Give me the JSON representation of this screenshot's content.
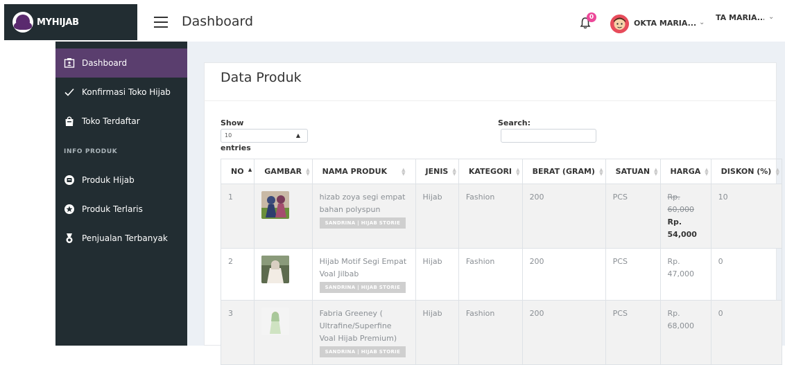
{
  "brand": {
    "name": "MYHIJAB"
  },
  "header": {
    "title": "Dashboard",
    "notification_count": "0",
    "user_name": "OKTA MARIA...",
    "user_name_overflow": "TA MARIA..."
  },
  "sidebar": {
    "items": [
      {
        "label": "Dashboard",
        "icon": "dashboard-icon",
        "active": true
      },
      {
        "label": "Konfirmasi Toko Hijab",
        "icon": "check-icon"
      },
      {
        "label": "Toko Terdaftar",
        "icon": "shopping-bag-icon"
      }
    ],
    "section_header": "INFO PRODUK",
    "section_items": [
      {
        "label": "Produk Hijab",
        "icon": "box-icon"
      },
      {
        "label": "Produk Terlaris",
        "icon": "star-icon"
      },
      {
        "label": "Penjualan Terbanyak",
        "icon": "medal-icon"
      }
    ]
  },
  "content": {
    "card_title": "Data Produk",
    "show_label": "Show",
    "entries_value": "10",
    "entries_label": "entries",
    "search_label": "Search:",
    "search_value": "",
    "columns": [
      "NO",
      "GAMBAR",
      "NAMA PRODUK",
      "JENIS",
      "KATEGORI",
      "BERAT (GRAM)",
      "SATUAN",
      "HARGA",
      "DISKON (%)"
    ],
    "rows": [
      {
        "no": "1",
        "name": "hizab zoya segi empat bahan polyspun",
        "shop": "SANDRINA | HIJAB STORIE",
        "jenis": "Hijab",
        "kategori": "Fashion",
        "berat": "200",
        "satuan": "PCS",
        "harga_old": "Rp. 60,000",
        "harga_new": "Rp. 54,000",
        "diskon": "10"
      },
      {
        "no": "2",
        "name": "Hijab Motif Segi Empat Voal Jilbab",
        "shop": "SANDRINA | HIJAB STORIE",
        "jenis": "Hijab",
        "kategori": "Fashion",
        "berat": "200",
        "satuan": "PCS",
        "harga": "Rp. 47,000",
        "diskon": "0"
      },
      {
        "no": "3",
        "name": "Fabria Greeney ( Ultrafine/Superfine Voal Hijab Premium)",
        "shop": "SANDRINA | HIJAB STORIE",
        "jenis": "Hijab",
        "kategori": "Fashion",
        "berat": "200",
        "satuan": "PCS",
        "harga": "Rp. 68,000",
        "diskon": "0"
      }
    ]
  },
  "colors": {
    "sidebar_bg": "#222d32",
    "sidebar_active": "#5a3e6e",
    "content_bg": "#ecf0f5",
    "badge_pink": "#ec4899"
  }
}
